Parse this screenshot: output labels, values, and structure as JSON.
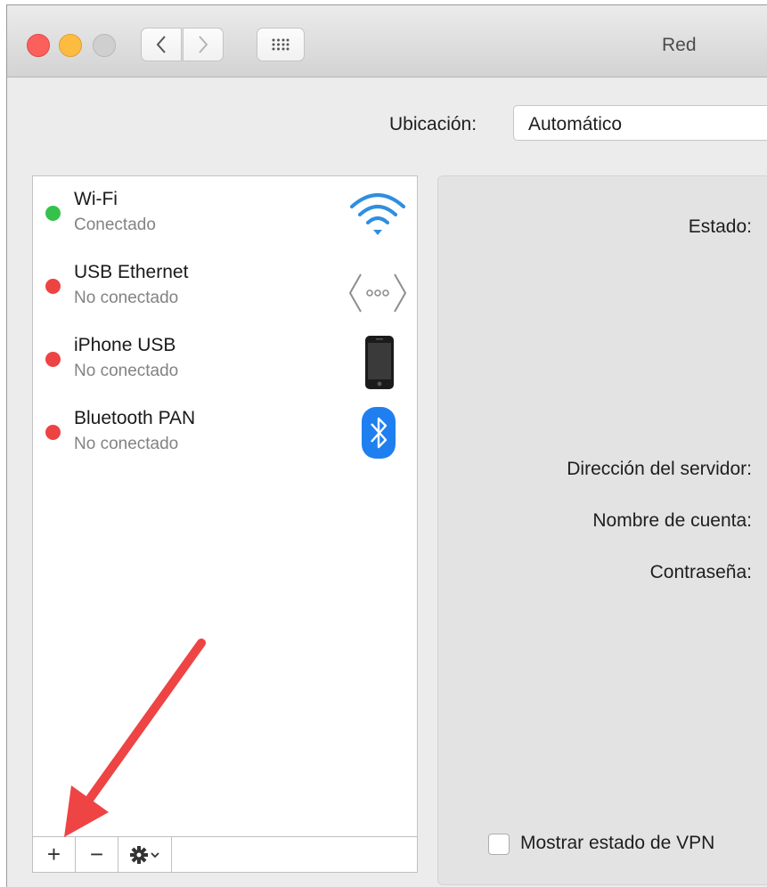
{
  "window": {
    "title": "Red"
  },
  "location": {
    "label": "Ubicación:",
    "value": "Automático"
  },
  "services": [
    {
      "name": "Wi-Fi",
      "status": "Conectado",
      "status_color": "#35c24a",
      "icon": "wifi-icon"
    },
    {
      "name": "USB Ethernet",
      "status": "No conectado",
      "status_color": "#ee4343",
      "icon": "ethernet-icon"
    },
    {
      "name": "iPhone USB",
      "status": "No conectado",
      "status_color": "#ee4343",
      "icon": "iphone-icon"
    },
    {
      "name": "Bluetooth PAN",
      "status": "No conectado",
      "status_color": "#ee4343",
      "icon": "bluetooth-icon"
    }
  ],
  "toolbar": {
    "add_label": "+",
    "remove_label": "−"
  },
  "detail": {
    "status_label": "Estado:",
    "server_label": "Dirección del servidor:",
    "account_label": "Nombre de cuenta:",
    "password_label": "Contraseña:",
    "show_vpn_label": "Mostrar estado de VPN"
  },
  "annotation": {
    "arrow_color": "#ee4444"
  }
}
